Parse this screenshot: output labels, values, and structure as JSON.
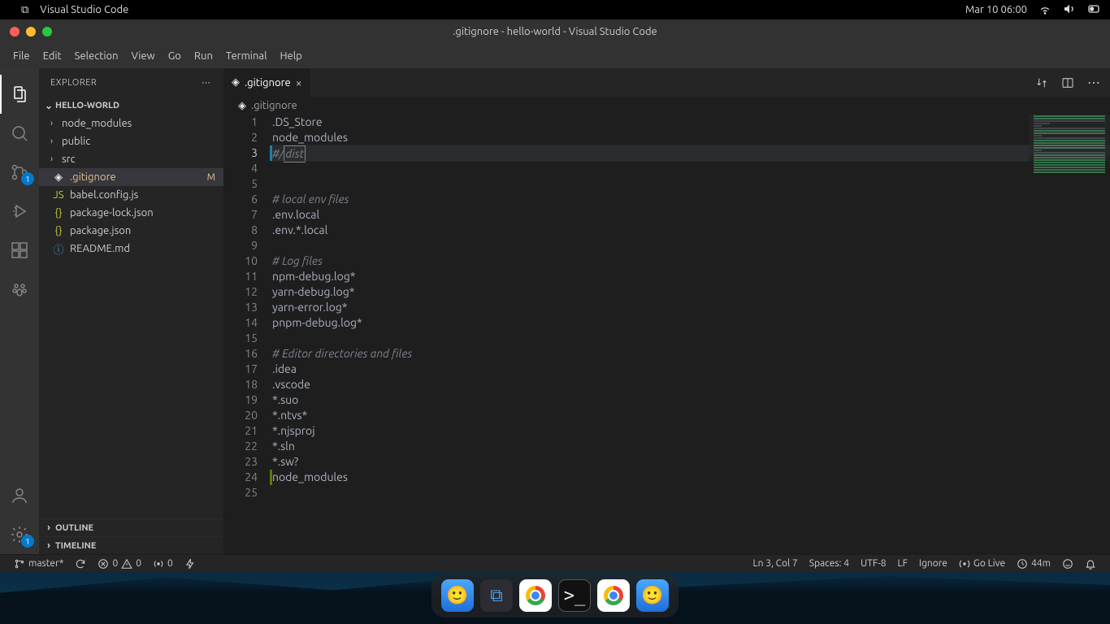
{
  "mac": {
    "app_name": "Visual Studio Code",
    "clock": "Mar 10  06:00"
  },
  "window": {
    "title": ".gitignore - hello-world - Visual Studio Code"
  },
  "menu": [
    "File",
    "Edit",
    "Selection",
    "View",
    "Go",
    "Run",
    "Terminal",
    "Help"
  ],
  "activity": {
    "scm_badge": "1",
    "settings_badge": "1"
  },
  "explorer": {
    "title": "EXPLORER",
    "root": "HELLO-WORLD",
    "tree": [
      {
        "type": "folder",
        "name": "node_modules"
      },
      {
        "type": "folder",
        "name": "public"
      },
      {
        "type": "folder",
        "name": "src"
      },
      {
        "type": "file",
        "name": ".gitignore",
        "icon": "git",
        "selected": true,
        "modified": true,
        "status": "M"
      },
      {
        "type": "file",
        "name": "babel.config.js",
        "icon": "js"
      },
      {
        "type": "file",
        "name": "package-lock.json",
        "icon": "json"
      },
      {
        "type": "file",
        "name": "package.json",
        "icon": "json"
      },
      {
        "type": "file",
        "name": "README.md",
        "icon": "md"
      }
    ],
    "outline": "OUTLINE",
    "timeline": "TIMELINE"
  },
  "tab": {
    "label": ".gitignore"
  },
  "breadcrumb": ".gitignore",
  "code": {
    "lines": [
      {
        "n": 1,
        "t": ".DS_Store"
      },
      {
        "n": 2,
        "t": "node_modules"
      },
      {
        "n": 3,
        "t": "#/",
        "cls": "comment",
        "cur": true,
        "sel": "dist",
        "bar": "blue"
      },
      {
        "n": 4,
        "t": ""
      },
      {
        "n": 5,
        "t": ""
      },
      {
        "n": 6,
        "t": "# local env files",
        "cls": "comment"
      },
      {
        "n": 7,
        "t": ".env.local"
      },
      {
        "n": 8,
        "t": ".env.*.local"
      },
      {
        "n": 9,
        "t": ""
      },
      {
        "n": 10,
        "t": "# Log files",
        "cls": "comment"
      },
      {
        "n": 11,
        "t": "npm-debug.log*"
      },
      {
        "n": 12,
        "t": "yarn-debug.log*"
      },
      {
        "n": 13,
        "t": "yarn-error.log*"
      },
      {
        "n": 14,
        "t": "pnpm-debug.log*"
      },
      {
        "n": 15,
        "t": ""
      },
      {
        "n": 16,
        "t": "# Editor directories and files",
        "cls": "comment"
      },
      {
        "n": 17,
        "t": ".idea"
      },
      {
        "n": 18,
        "t": ".vscode"
      },
      {
        "n": 19,
        "t": "*.suo"
      },
      {
        "n": 20,
        "t": "*.ntvs*"
      },
      {
        "n": 21,
        "t": "*.njsproj"
      },
      {
        "n": 22,
        "t": "*.sln"
      },
      {
        "n": 23,
        "t": "*.sw?"
      },
      {
        "n": 24,
        "t": "node_modules",
        "bar": "green"
      },
      {
        "n": 25,
        "t": ""
      }
    ]
  },
  "status": {
    "branch": "master*",
    "sync": "",
    "errors": "0",
    "warnings": "0",
    "port": "0",
    "cursor": "Ln 3, Col 7",
    "spaces": "Spaces: 4",
    "encoding": "UTF-8",
    "eol": "LF",
    "lang": "Ignore",
    "golive": "Go Live",
    "time": "44m"
  }
}
